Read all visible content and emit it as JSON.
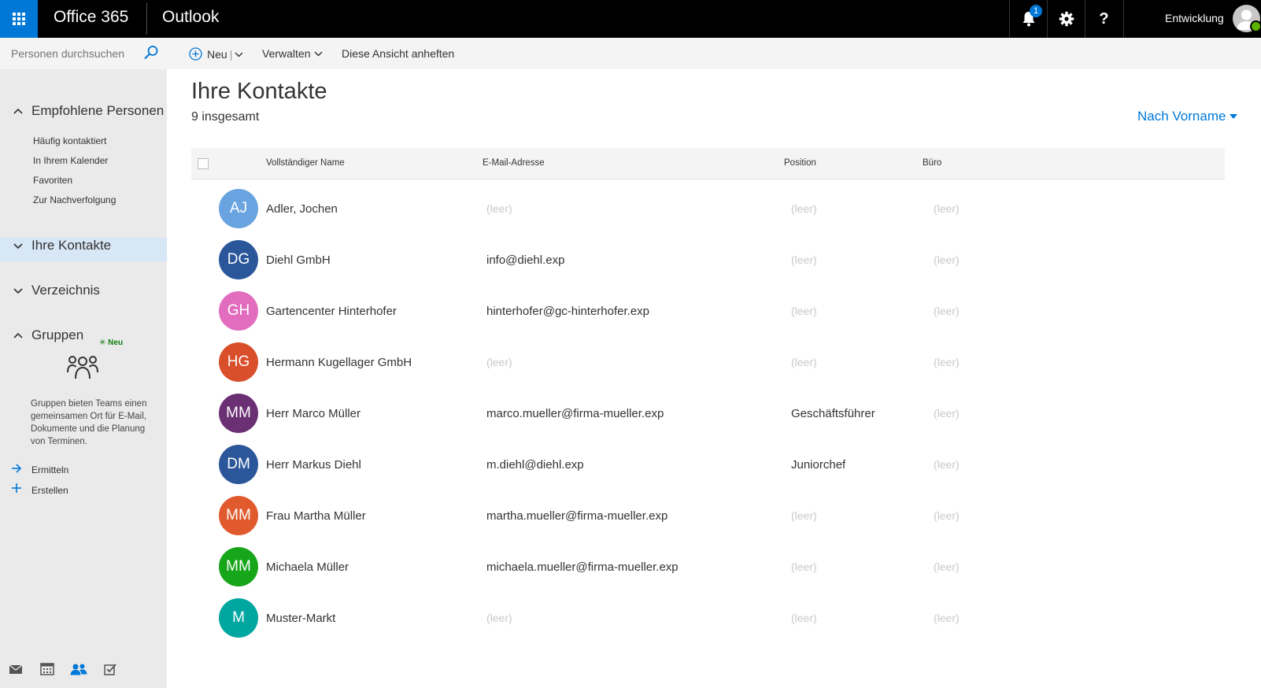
{
  "header": {
    "suite": "Office 365",
    "app": "Outlook",
    "notification_count": "1",
    "help_label": "?",
    "user_name": "Entwicklung"
  },
  "search": {
    "placeholder": "Personen durchsuchen"
  },
  "sidebar": {
    "recommended": "Empfohlene Personen",
    "recommended_items": [
      "Häufig kontaktiert",
      "In Ihrem Kalender",
      "Favoriten",
      "Zur Nachverfolgung"
    ],
    "contacts": "Ihre Kontakte",
    "directory": "Verzeichnis",
    "groups": "Gruppen",
    "groups_new_tag": "Neu",
    "groups_description": "Gruppen bieten Teams einen gemeinsamen Ort für E-Mail, Dokumente und die Planung von Terminen.",
    "discover": "Ermitteln",
    "create": "Erstellen"
  },
  "toolbar": {
    "new_label": "Neu",
    "manage_label": "Verwalten",
    "pin_label": "Diese Ansicht anheften"
  },
  "main": {
    "title": "Ihre Kontakte",
    "count": "9 insgesamt",
    "sort_label": "Nach Vorname"
  },
  "table": {
    "columns": [
      "Vollständiger Name",
      "E-Mail-Adresse",
      "Position",
      "Büro"
    ],
    "empty_label": "(leer)",
    "rows": [
      {
        "initials": "AJ",
        "color": "#69a3e0",
        "name": "Adler, Jochen",
        "email": "",
        "position": "",
        "office": ""
      },
      {
        "initials": "DG",
        "color": "#2b579a",
        "name": "Diehl GmbH",
        "email": "info@diehl.exp",
        "position": "",
        "office": ""
      },
      {
        "initials": "GH",
        "color": "#e26dbe",
        "name": "Gartencenter Hinterhofer",
        "email": "hinterhofer@gc-hinterhofer.exp",
        "position": "",
        "office": ""
      },
      {
        "initials": "HG",
        "color": "#d94f2b",
        "name": "Hermann Kugellager GmbH",
        "email": "",
        "position": "",
        "office": ""
      },
      {
        "initials": "MM",
        "color": "#6b2f73",
        "name": "Herr Marco Müller",
        "email": "marco.mueller@firma-mueller.exp",
        "position": "Geschäftsführer",
        "office": ""
      },
      {
        "initials": "DM",
        "color": "#2b579a",
        "name": "Herr Markus Diehl",
        "email": "m.diehl@diehl.exp",
        "position": "Juniorchef",
        "office": ""
      },
      {
        "initials": "MM",
        "color": "#e05a2d",
        "name": "Frau Martha Müller",
        "email": "martha.mueller@firma-mueller.exp",
        "position": "",
        "office": ""
      },
      {
        "initials": "MM",
        "color": "#17a51a",
        "name": "Michaela Müller",
        "email": "michaela.mueller@firma-mueller.exp",
        "position": "",
        "office": ""
      },
      {
        "initials": "M",
        "color": "#00a6a0",
        "name": "Muster-Markt",
        "email": "",
        "position": "",
        "office": ""
      }
    ]
  },
  "bottom_nav": [
    "mail-icon",
    "calendar-icon",
    "people-icon",
    "tasks-icon"
  ]
}
